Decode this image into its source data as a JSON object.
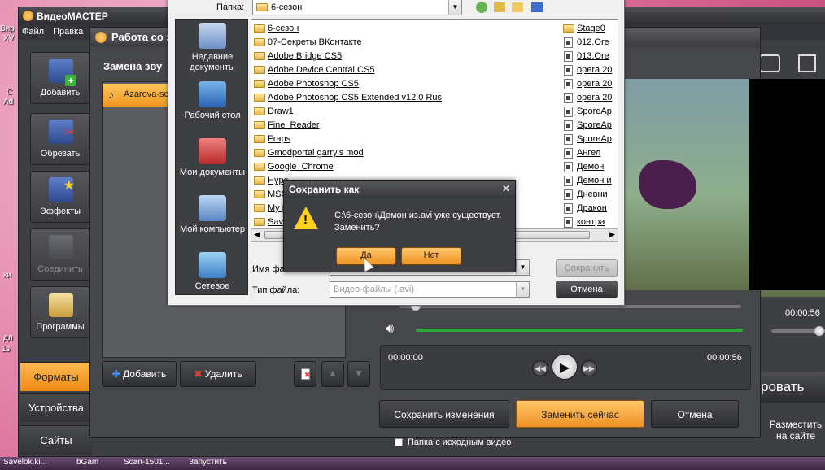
{
  "desktop": {
    "icons": [
      "Вир",
      "XV",
      "С",
      "Ad",
      "ки",
      "дл",
      "1з"
    ],
    "taskbar": [
      "Savelok.ki...",
      "bGam",
      "Scan-1501...",
      "Запустить"
    ]
  },
  "app": {
    "title": "ВидеоМАСТЕР",
    "menu": [
      "Файл",
      "Правка"
    ],
    "sidebar": [
      {
        "label": "Добавить",
        "icon": "film-add-icon"
      },
      {
        "label": "Обрезать",
        "icon": "scissors-icon"
      },
      {
        "label": "Эффекты",
        "icon": "magic-wand-icon"
      },
      {
        "label": "Соединить",
        "icon": "join-icon"
      },
      {
        "label": "Программы",
        "icon": "programs-icon"
      }
    ],
    "tabs": [
      "Форматы",
      "Устройства",
      "Сайты"
    ],
    "right_labels": {
      "convert": "ровать",
      "publish": "Разместить\nна сайте"
    }
  },
  "audio_window": {
    "title": "Работа со з",
    "panel_title": "Замена зву",
    "track": "Azarova-sc",
    "add_label": "Добавить",
    "delete_label": "Удалить",
    "time_start": "00:00:00",
    "time_end": "00:00:56",
    "time_right": "00:00:56",
    "save_changes": "Сохранить изменения",
    "replace_now": "Заменить сейчас",
    "cancel": "Отмена",
    "source_folder_checkbox": "Папка с исходным видео"
  },
  "file_dialog": {
    "folder_label": "Папка:",
    "folder_value": "6-сезон",
    "places": [
      "Недавние документы",
      "Рабочий стол",
      "Мои документы",
      "Мой компьютер",
      "Сетевое"
    ],
    "left_column": [
      {
        "name": "6-сезон",
        "type": "folder"
      },
      {
        "name": "07-Секреты ВКонтакте",
        "type": "folder"
      },
      {
        "name": "Adobe Bridge CS5",
        "type": "folder"
      },
      {
        "name": "Adobe Device Central CS5",
        "type": "folder"
      },
      {
        "name": "Adobe Photoshop CS5",
        "type": "folder"
      },
      {
        "name": "Adobe Photoshop CS5 Extended v12.0 Rus",
        "type": "folder"
      },
      {
        "name": "Draw1",
        "type": "folder"
      },
      {
        "name": "Fine_Reader",
        "type": "folder"
      },
      {
        "name": "Fraps",
        "type": "folder"
      },
      {
        "name": "Gmodportal garry's mod",
        "type": "folder"
      },
      {
        "name": "Google_Chrome",
        "type": "folder"
      },
      {
        "name": "Hype",
        "type": "folder"
      },
      {
        "name": "MSO",
        "type": "folder"
      },
      {
        "name": "My p",
        "type": "folder"
      },
      {
        "name": "Save",
        "type": "folder"
      }
    ],
    "right_column": [
      {
        "name": "Stage0",
        "type": "folder"
      },
      {
        "name": "012.Ore",
        "type": "file"
      },
      {
        "name": "013.Ore",
        "type": "file"
      },
      {
        "name": "opera 20",
        "type": "file"
      },
      {
        "name": "opera 20",
        "type": "file"
      },
      {
        "name": "opera 20",
        "type": "file"
      },
      {
        "name": "SporeAp",
        "type": "file"
      },
      {
        "name": "SporeAp",
        "type": "file"
      },
      {
        "name": "SporeAp",
        "type": "file"
      },
      {
        "name": "Ангел",
        "type": "file"
      },
      {
        "name": "Демон",
        "type": "file"
      },
      {
        "name": "Демон и",
        "type": "file"
      },
      {
        "name": "Дневни",
        "type": "file"
      },
      {
        "name": "Дракон",
        "type": "file"
      },
      {
        "name": "контра",
        "type": "file"
      }
    ],
    "filename_label": "Имя фа",
    "filetype_label": "Тип файла:",
    "filetype_value": "Видео-файлы (.avi)",
    "save_label": "Сохранить",
    "cancel_label": "Отмена"
  },
  "confirm": {
    "title": "Сохранить как",
    "message": "C:\\6-сезон\\Демон из.avi уже существует.\nЗаменить?",
    "yes": "Да",
    "no": "Нет"
  }
}
